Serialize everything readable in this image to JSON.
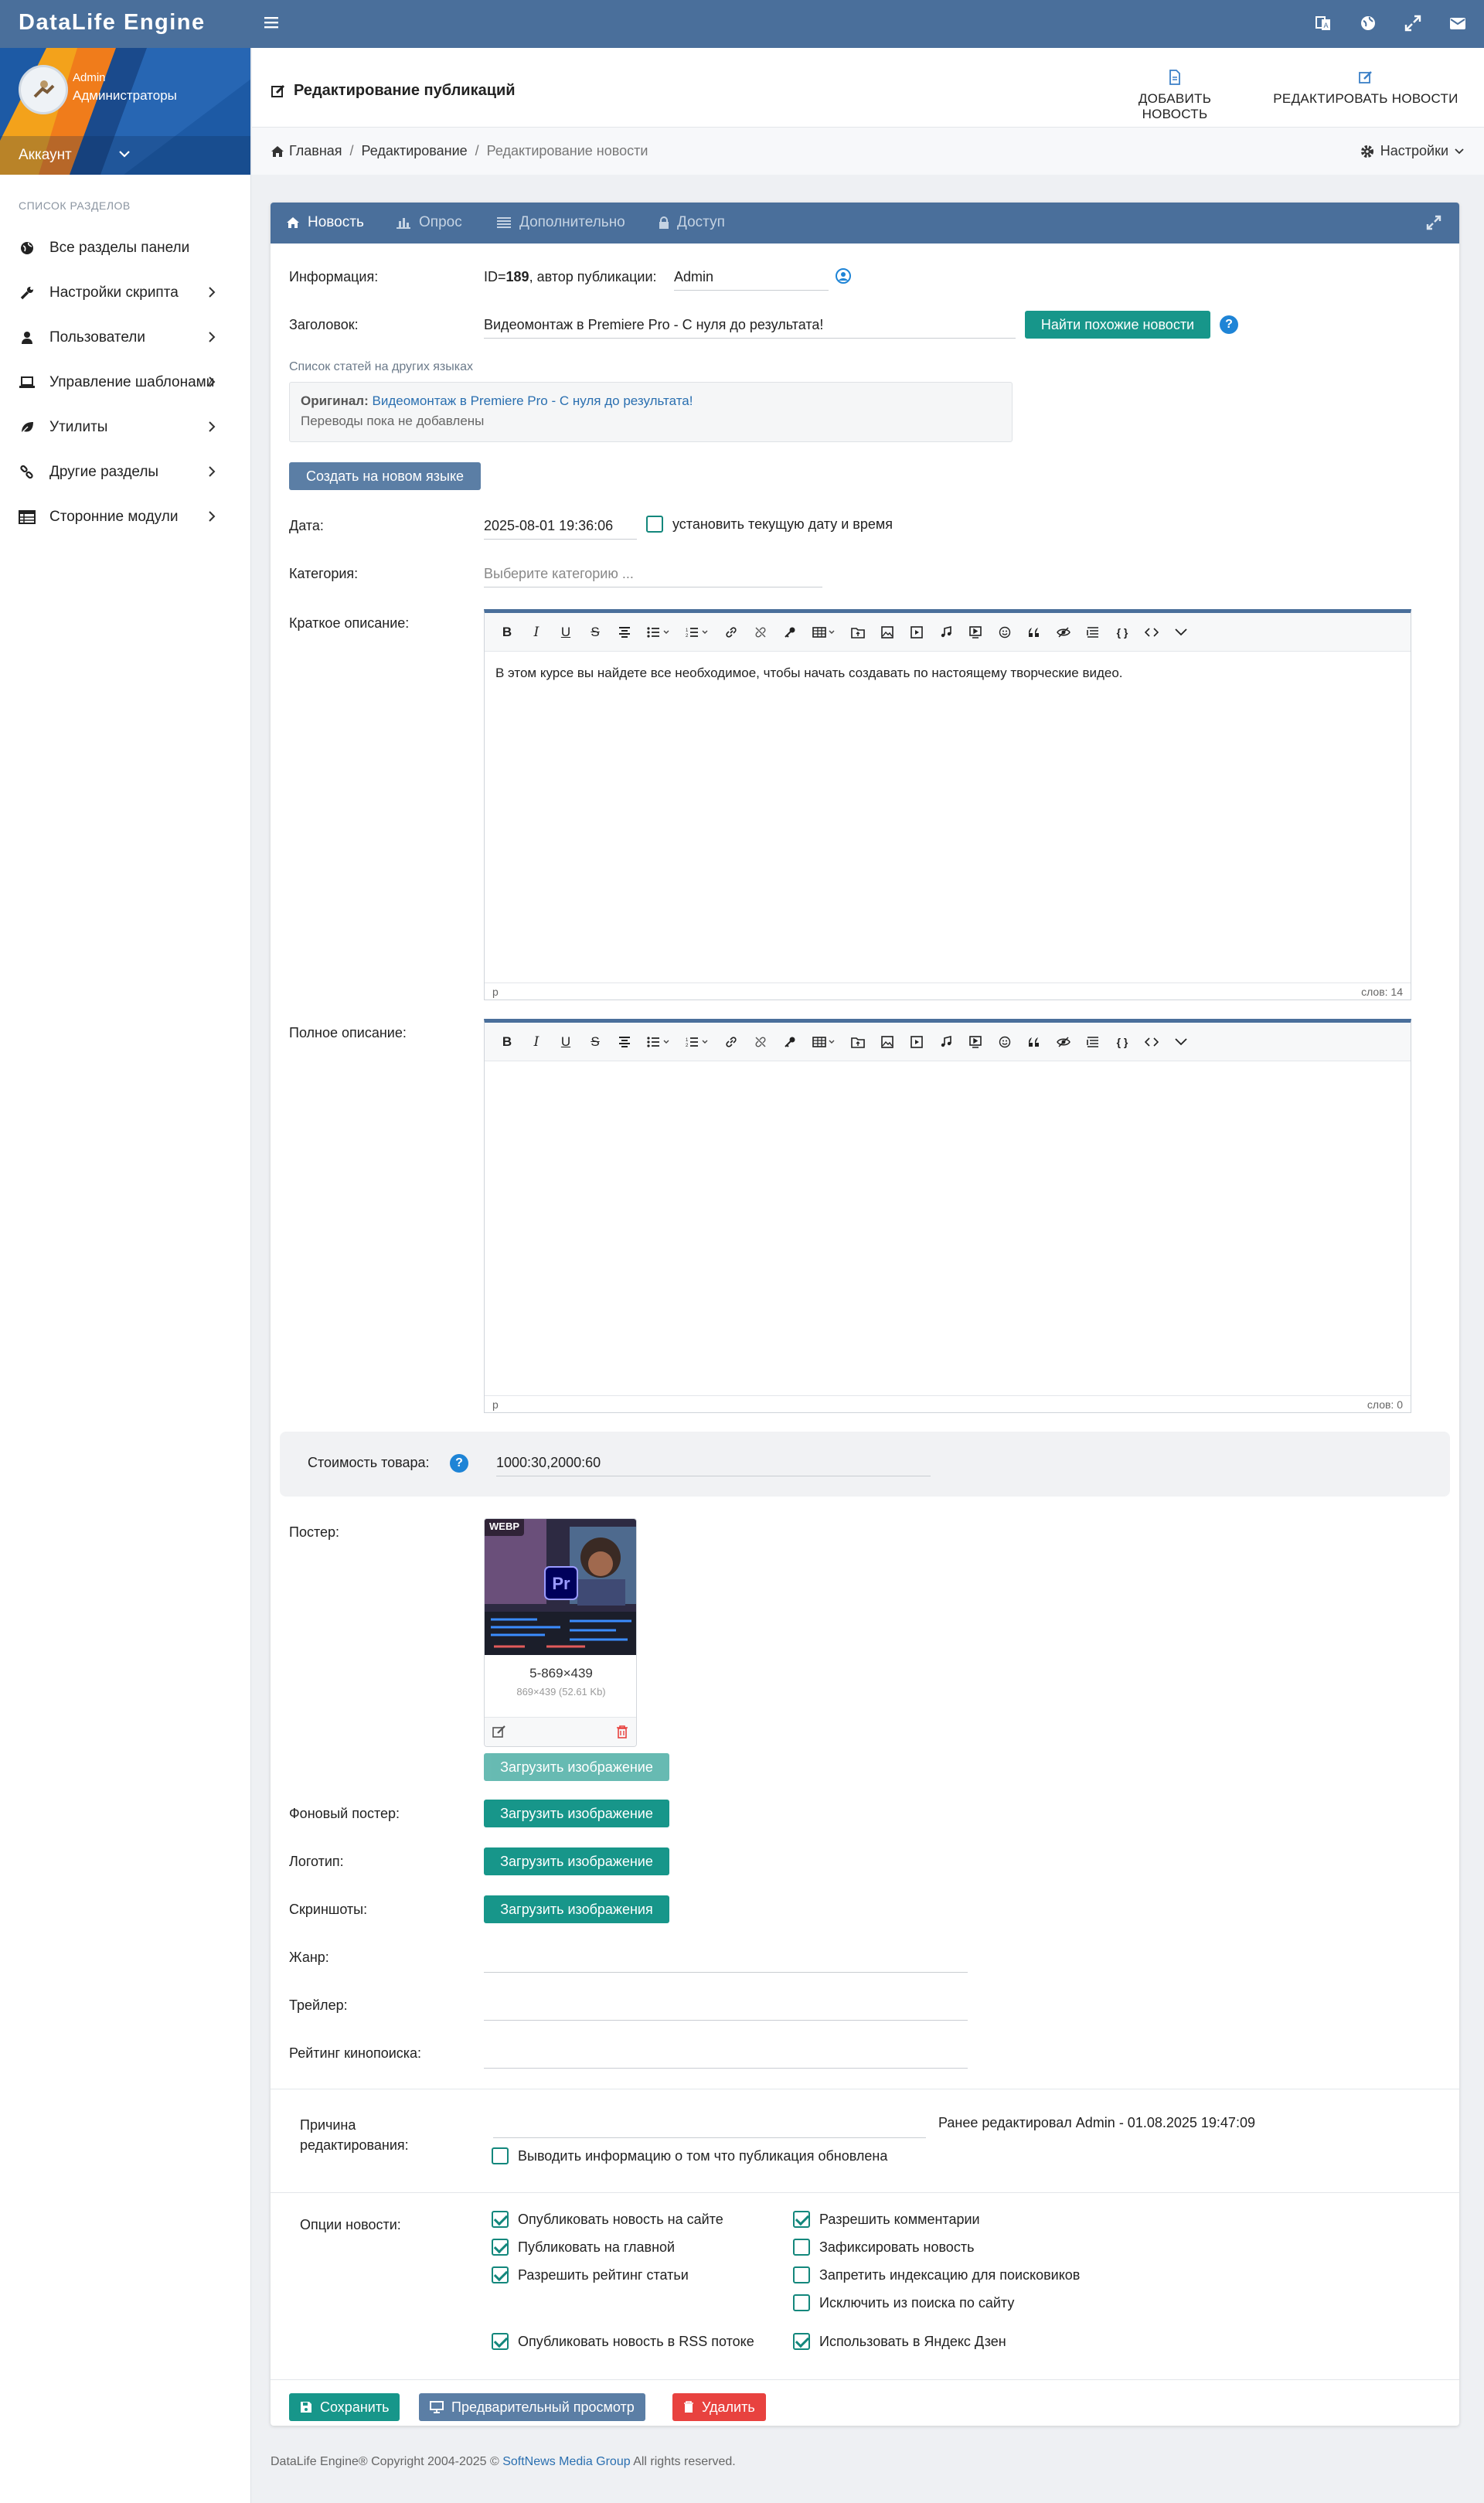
{
  "app": {
    "brand": "DataLife Engine"
  },
  "sidebar": {
    "user_name": "Admin",
    "user_role": "Администраторы",
    "account_label": "Аккаунт",
    "section_title": "СПИСОК РАЗДЕЛОВ",
    "items": [
      {
        "label": "Все разделы панели",
        "icon": "globe-icon"
      },
      {
        "label": "Настройки скрипта",
        "icon": "wrench-icon"
      },
      {
        "label": "Пользователи",
        "icon": "user-icon"
      },
      {
        "label": "Управление шаблонами",
        "icon": "laptop-icon"
      },
      {
        "label": "Утилиты",
        "icon": "leaf-icon"
      },
      {
        "label": "Другие разделы",
        "icon": "link-icon"
      },
      {
        "label": "Сторонние модули",
        "icon": "table-icon"
      }
    ]
  },
  "header": {
    "title": "Редактирование публикаций",
    "add_news": "ДОБАВИТЬ НОВОСТЬ",
    "edit_news": "РЕДАКТИРОВАТЬ НОВОСТИ",
    "breadcrumb": [
      "Главная",
      "Редактирование",
      "Редактирование новости"
    ],
    "settings": "Настройки"
  },
  "tabs": [
    "Новость",
    "Опрос",
    "Дополнительно",
    "Доступ"
  ],
  "form": {
    "info_label": "Информация:",
    "info_prefix": "ID=",
    "info_id": "189",
    "info_suffix": ", автор публикации:",
    "author": "Admin",
    "title_label": "Заголовок:",
    "title_value": "Видеомонтаж в Premiere Pro - С нуля до результата!",
    "find_similar": "Найти похожие новости",
    "lang_list_title": "Список статей на других языках",
    "original_label": "Оригинал:",
    "original_link": "Видеомонтаж в Premiere Pro - С нуля до результата!",
    "no_translations": "Переводы пока не добавлены",
    "create_lang": "Создать на новом языке",
    "date_label": "Дата:",
    "date_value": "2025-08-01 19:36:06",
    "set_current_date": "установить текущую дату и время",
    "category_label": "Категория:",
    "category_placeholder": "Выберите категорию ...",
    "short_label": "Краткое описание:",
    "short_text": "В этом курсе вы найдете все необходимое, чтобы начать создавать по настоящему творческие видео.",
    "short_status_tag": "p",
    "short_words": "слов: 14",
    "full_label": "Полное описание:",
    "full_status_tag": "p",
    "full_words": "слов: 0",
    "price_label": "Стоимость товара:",
    "price_value": "1000:30,2000:60",
    "poster_label": "Постер:",
    "poster_badge": "WEBP",
    "poster_logo": "Pr",
    "poster_name": "5-869×439",
    "poster_meta": "869×439 (52.61 Kb)",
    "upload_image": "Загрузить изображение",
    "bg_poster_label": "Фоновый постер:",
    "logo_label": "Логотип:",
    "screens_label": "Скриншоты:",
    "upload_images": "Загрузить изображения",
    "genre_label": "Жанр:",
    "trailer_label": "Трейлер:",
    "rating_label": "Рейтинг кинопоиска:",
    "reason_label_1": "Причина",
    "reason_label_2": "редактирования:",
    "last_edited": "Ранее редактировал Admin - 01.08.2025 19:47:09",
    "show_updated": "Выводить информацию о том что публикация обновлена",
    "options_label": "Опции новости:"
  },
  "options_left": [
    {
      "label": "Опубликовать новость на сайте",
      "checked": true
    },
    {
      "label": "Публиковать на главной",
      "checked": true
    },
    {
      "label": "Разрешить рейтинг статьи",
      "checked": true
    }
  ],
  "options_right": [
    {
      "label": "Разрешить комментарии",
      "checked": true
    },
    {
      "label": "Зафиксировать новость",
      "checked": false
    },
    {
      "label": "Запретить индексацию для поисковиков",
      "checked": false
    },
    {
      "label": "Исключить из поиска по сайту",
      "checked": false
    }
  ],
  "options_bottom": [
    {
      "label": "Опубликовать новость в RSS потоке",
      "checked": true
    },
    {
      "label": "Использовать в Яндекс Дзен",
      "checked": true
    }
  ],
  "actions": {
    "save": "Сохранить",
    "preview": "Предварительный просмотр",
    "delete": "Удалить"
  },
  "footer": {
    "prefix": "DataLife Engine® Copyright 2004-2025 ©",
    "company": "SoftNews Media Group",
    "suffix": "All rights reserved."
  },
  "colors": {
    "header": "#4a6f9b",
    "teal": "#17968a",
    "danger": "#e8423f"
  }
}
